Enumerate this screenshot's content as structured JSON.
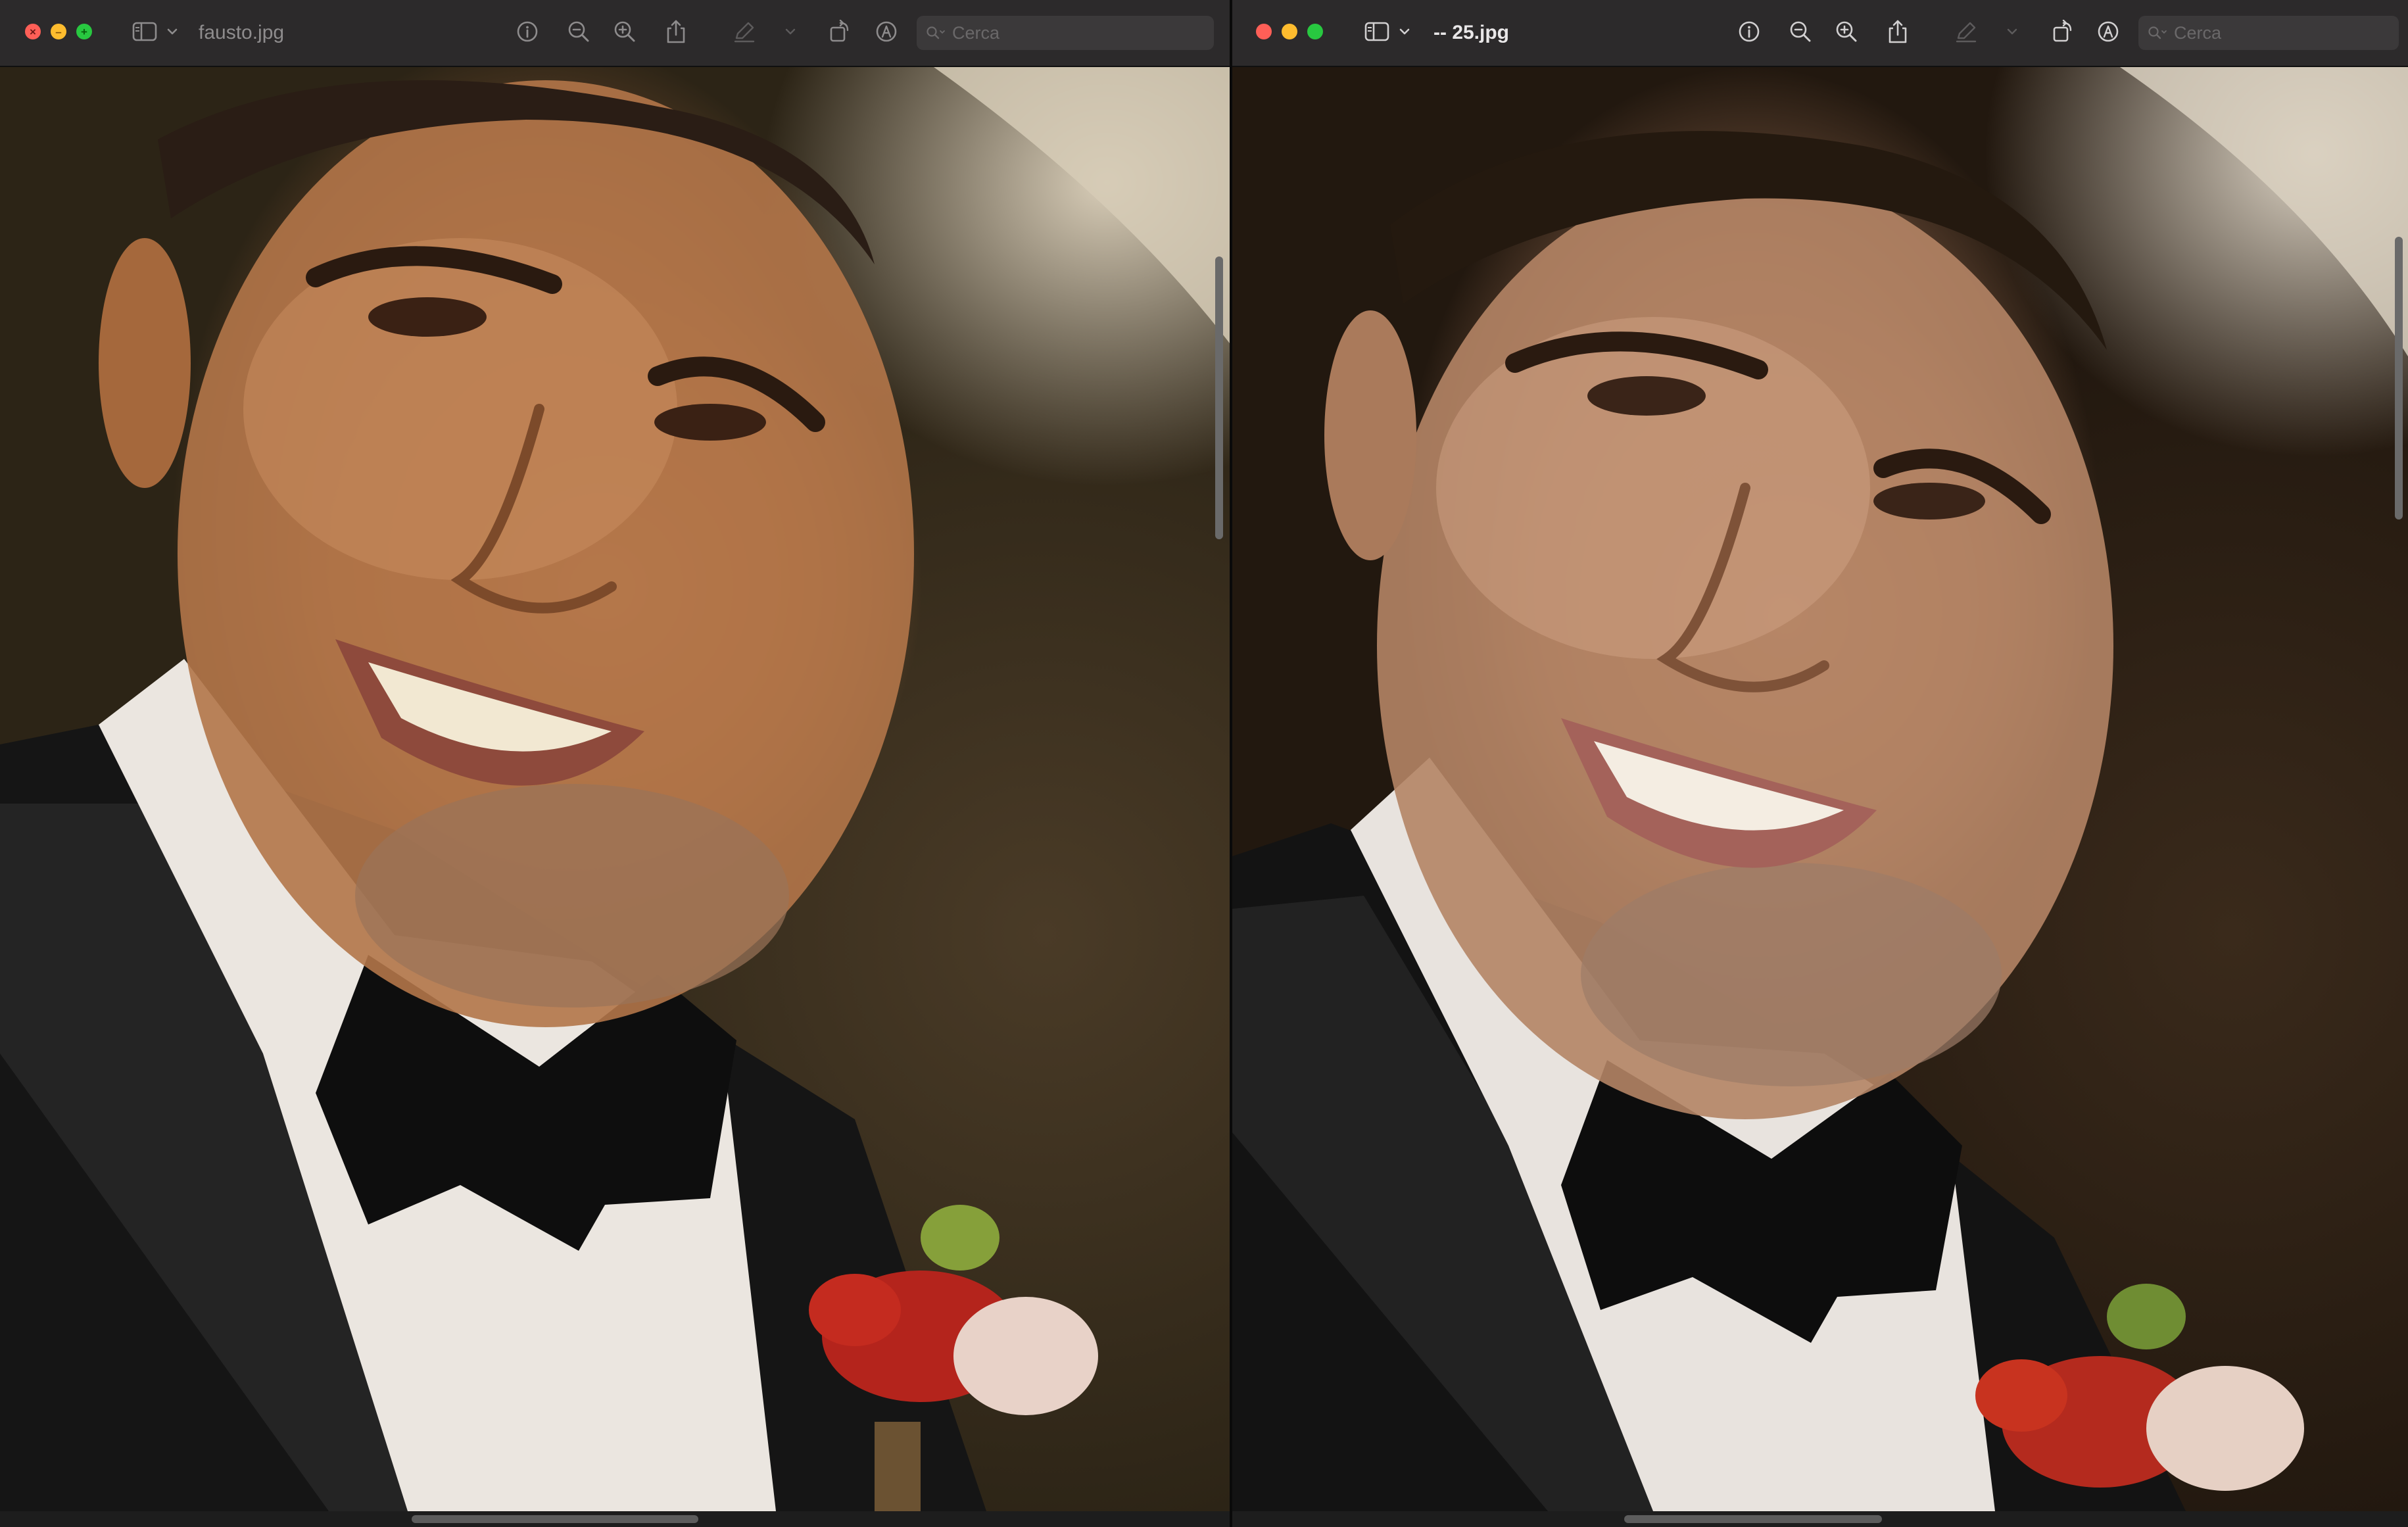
{
  "colors": {
    "traffic_red": "#fe5f57",
    "traffic_yellow": "#febc2e",
    "traffic_green": "#28c840",
    "titlebar": "#2c2a2b"
  },
  "windows": [
    {
      "id": "left",
      "filename": "fausto.jpg",
      "search_placeholder": "Cerca",
      "icons": [
        "sidebar-icon",
        "chevron-down-icon",
        "info-icon",
        "zoom-out-icon",
        "zoom-in-icon",
        "share-icon",
        "markup-pen-icon",
        "rotate-icon",
        "annotate-icon",
        "search-icon"
      ]
    },
    {
      "id": "right",
      "filename": "-- 25.jpg",
      "search_placeholder": "Cerca",
      "icons": [
        "sidebar-icon",
        "chevron-down-icon",
        "info-icon",
        "zoom-out-icon",
        "zoom-in-icon",
        "share-icon",
        "markup-pen-icon",
        "rotate-icon",
        "annotate-icon",
        "search-icon"
      ]
    }
  ]
}
